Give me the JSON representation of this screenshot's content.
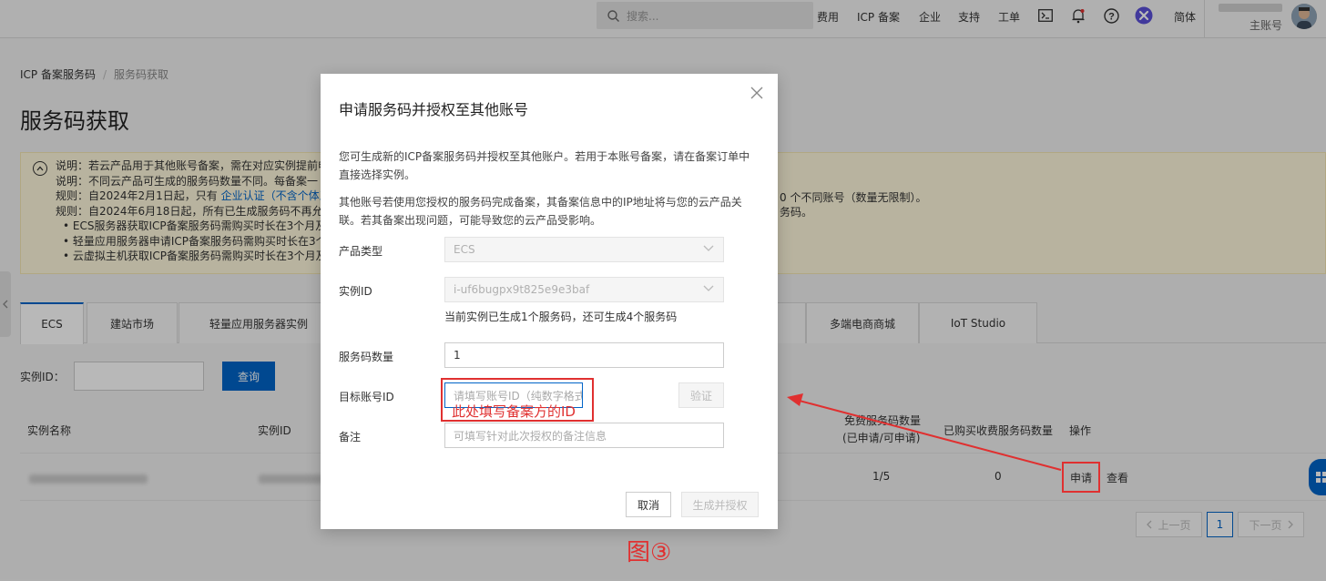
{
  "topbar": {
    "search_placeholder": "搜索...",
    "nav": [
      "费用",
      "ICP 备案",
      "企业",
      "支持",
      "工单"
    ],
    "lang": "简体",
    "account_role": "主账号"
  },
  "breadcrumb": {
    "parent": "ICP 备案服务码",
    "current": "服务码获取"
  },
  "page_title": "服务码获取",
  "notice": {
    "lines": [
      "说明：若云产品用于其他账号备案，需在对应实例提前申",
      "说明：不同云产品可生成的服务码数量不同。每备案一",
      "规则：自2024年2月1日起，只有",
      "规则：自2024年6月18日起，所有已生成服务码不再允许",
      "• ECS服务器获取ICP备案服务码需购买时长在3个月及以",
      "• 轻量应用服务器申请ICP备案服务码需购买时长在3个月",
      "• 云虚拟主机获取ICP备案服务码需购买时长在3个月及以"
    ],
    "link_text": "企业认证（不含个体工",
    "tail1": "0 个不同账号（数量无限制）。",
    "tail2": "务码。"
  },
  "tabs": [
    {
      "label": "ECS",
      "active": true
    },
    {
      "label": "建站市场"
    },
    {
      "label": "轻量应用服务器实例"
    },
    {
      "label": ""
    },
    {
      "label": "多端电商商城"
    },
    {
      "label": "IoT Studio"
    }
  ],
  "filter": {
    "label": "实例ID：",
    "button": "查询"
  },
  "table": {
    "headers": {
      "name": "实例名称",
      "id": "实例ID",
      "free_count": "免费服务码数量",
      "free_count_sub": "(已申请/可申请)",
      "paid_count": "已购买收费服务码数量",
      "actions": "操作"
    },
    "row": {
      "free": "1/5",
      "paid": "0",
      "apply": "申请",
      "view": "查看"
    }
  },
  "pagination": {
    "prev": "上一页",
    "page": "1",
    "next": "下一页"
  },
  "dialog": {
    "title": "申请服务码并授权至其他账号",
    "desc1": "您可生成新的ICP备案服务码并授权至其他账户。若用于本账号备案，请在备案订单中直接选择实例。",
    "desc2": "其他账号若使用您授权的服务码完成备案，其备案信息中的IP地址将与您的云产品关联。若其备案出现问题，可能导致您的云产品受影响。",
    "product_label": "产品类型",
    "product_value": "ECS",
    "instance_label": "实例ID",
    "instance_value": "i-uf6bugpx9t825e9e3baf",
    "instance_hint": "当前实例已生成1个服务码，还可生成4个服务码",
    "count_label": "服务码数量",
    "count_value": "1",
    "target_label": "目标账号ID",
    "target_placeholder": "请填写账号ID（纯数字格式）",
    "verify": "验证",
    "remark_label": "备注",
    "remark_placeholder": "可填写针对此次授权的备注信息",
    "cancel": "取消",
    "generate": "生成并授权"
  },
  "annotation": {
    "note": "此处填写备案方的ID",
    "figure": "图③",
    "color": "#e03030"
  }
}
